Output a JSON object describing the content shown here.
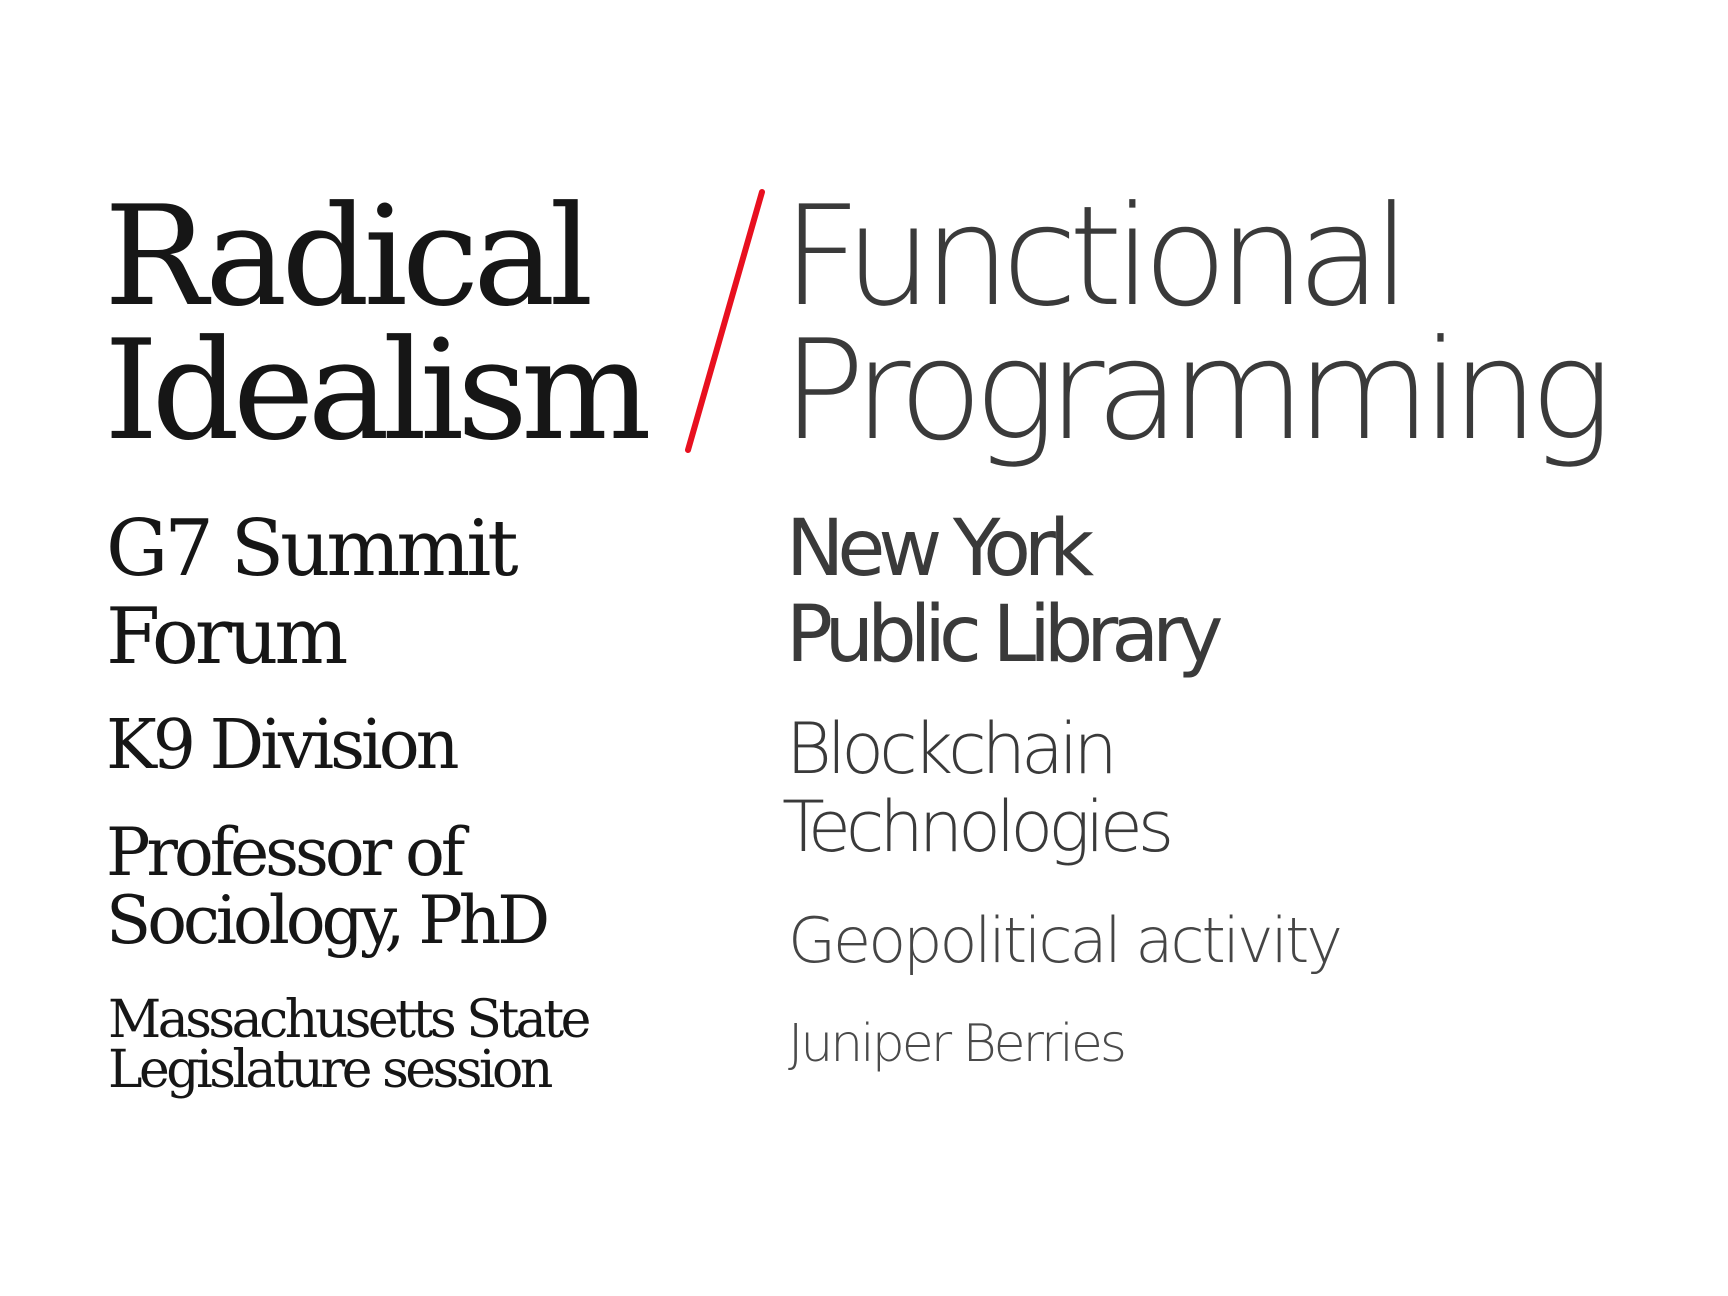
{
  "left": {
    "headline": [
      "Radical",
      "Idealism"
    ],
    "rows": [
      [
        "G7 Summit",
        "Forum"
      ],
      [
        "K9 Division"
      ],
      [
        "Professor of",
        "Sociology, PhD"
      ],
      [
        "Massachusetts State",
        "Legislature session"
      ]
    ]
  },
  "right": {
    "headline": [
      "Functional",
      "Programming"
    ],
    "rows": [
      [
        "New York",
        "Public Library"
      ],
      [
        "Blockchain",
        "Technologies"
      ],
      [
        "Geopolitical activity"
      ],
      [
        "Juniper Berries"
      ]
    ]
  },
  "colors": {
    "left_text": "#161616",
    "right_text": "#3a3a3a",
    "slash": "#e8101f",
    "background": "#ffffff"
  }
}
